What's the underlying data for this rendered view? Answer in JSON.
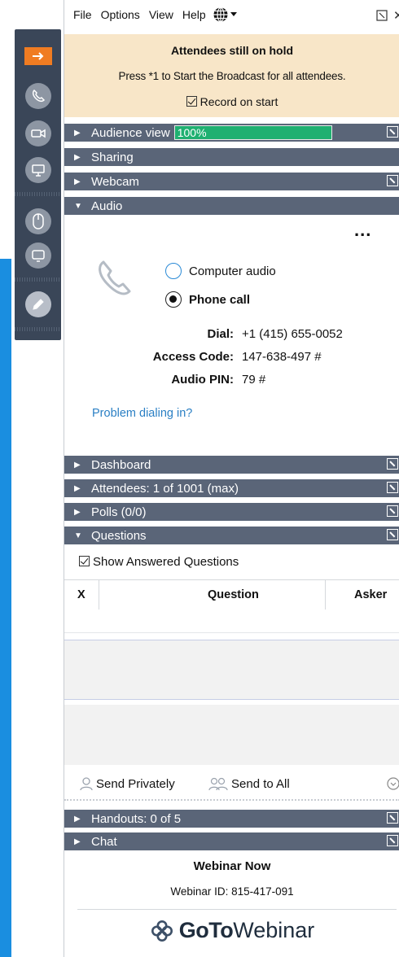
{
  "menu": {
    "file": "File",
    "options": "Options",
    "view": "View",
    "help": "Help"
  },
  "hold": {
    "title": "Attendees still on hold",
    "message": "Press *1 to Start the Broadcast for all attendees.",
    "record_label": "Record on start",
    "record_checked": true
  },
  "sections": {
    "audience_view": "Audience view",
    "audience_progress": "100%",
    "sharing": "Sharing",
    "webcam": "Webcam",
    "audio": "Audio",
    "dashboard": "Dashboard",
    "attendees": "Attendees:  1 of 1001 (max)",
    "polls": "Polls (0/0)",
    "questions": "Questions",
    "handouts": "Handouts: 0 of 5",
    "chat": "Chat"
  },
  "audio": {
    "more": "...",
    "computer_audio": "Computer audio",
    "phone_call": "Phone call",
    "selected": "phone_call",
    "dial_label": "Dial:",
    "dial_value": "+1 (415) 655-0052",
    "access_label": "Access Code:",
    "access_value": "147-638-497 #",
    "pin_label": "Audio PIN:",
    "pin_value": "79 #",
    "problem_link": "Problem dialing in?"
  },
  "questions": {
    "show_answered": "Show Answered Questions",
    "show_answered_checked": true,
    "columns": [
      "X",
      "Question",
      "Asker"
    ],
    "send_privately": "Send Privately",
    "send_to_all": "Send to All"
  },
  "footer": {
    "title": "Webinar Now",
    "webinar_id": "Webinar ID: 815-417-091",
    "logo_goto": "GoTo",
    "logo_webinar": "Webinar"
  },
  "colors": {
    "section_header": "#5a6578",
    "banner": "#f8e6c8",
    "accent": "#f07c22",
    "progress": "#1fb071",
    "link": "#2a7fc4",
    "blue_edge": "#1a8ee0"
  }
}
